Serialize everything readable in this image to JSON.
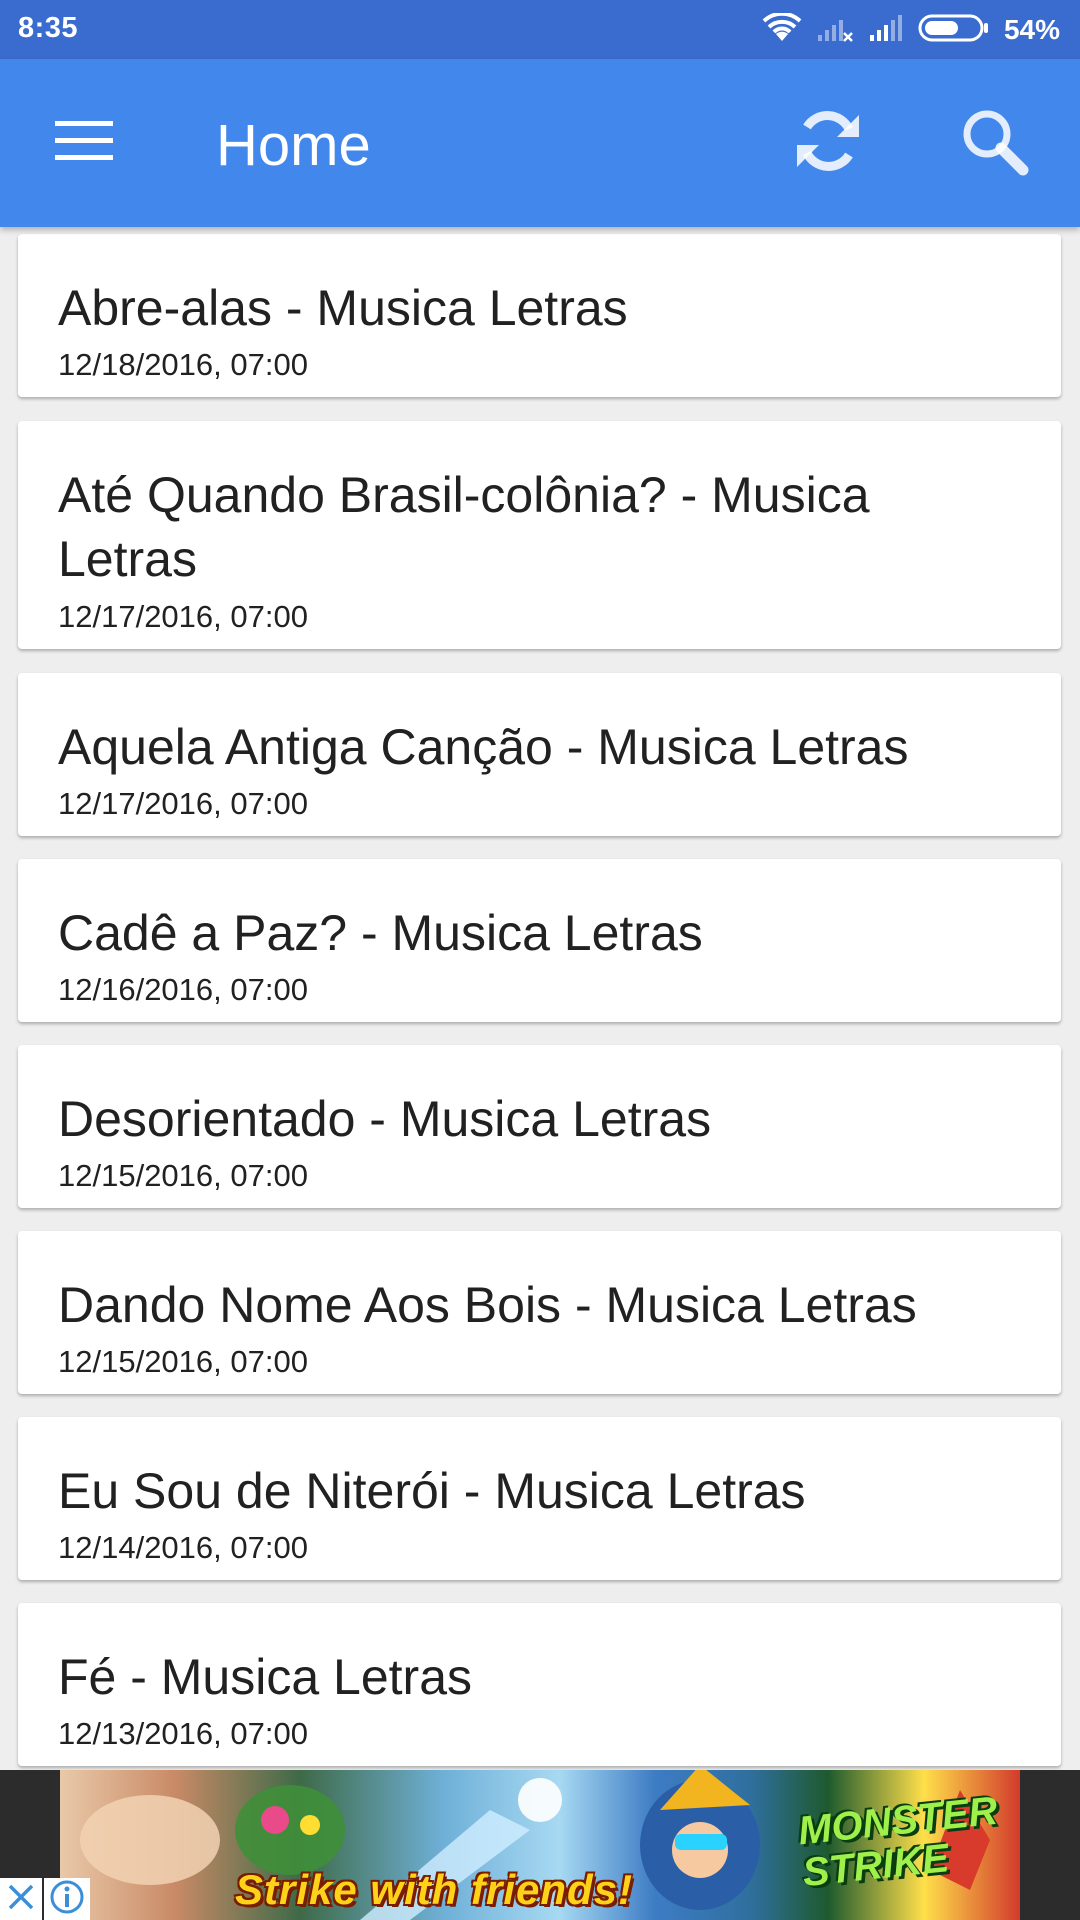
{
  "status_bar": {
    "time": "8:35",
    "battery": "54%",
    "icons": [
      "wifi-icon",
      "signal-no-sim-icon",
      "signal-icon",
      "battery-icon"
    ]
  },
  "app_bar": {
    "title": "Home",
    "menu_icon": "hamburger-menu-icon",
    "refresh_icon": "refresh-icon",
    "search_icon": "search-icon",
    "color": "#4287ec"
  },
  "posts": [
    {
      "title": "Abre-alas - Musica Letras",
      "date": "12/18/2016, 07:00"
    },
    {
      "title": "Até Quando Brasil-colônia? - Musica Letras",
      "date": "12/17/2016, 07:00"
    },
    {
      "title": "Aquela Antiga Canção - Musica Letras",
      "date": "12/17/2016, 07:00"
    },
    {
      "title": "Cadê a Paz? - Musica Letras",
      "date": "12/16/2016, 07:00"
    },
    {
      "title": "Desorientado - Musica Letras",
      "date": "12/15/2016, 07:00"
    },
    {
      "title": "Dando Nome Aos Bois - Musica Letras",
      "date": "12/15/2016, 07:00"
    },
    {
      "title": "Eu Sou de Niterói - Musica Letras",
      "date": "12/14/2016, 07:00"
    },
    {
      "title": "Fé - Musica Letras",
      "date": "12/13/2016, 07:00"
    }
  ],
  "ad": {
    "slogan": "Strike with friends!",
    "brand_line1": "MONSTER",
    "brand_line2": "STRIKE",
    "close_icon": "close-icon",
    "info_icon": "info-icon"
  }
}
